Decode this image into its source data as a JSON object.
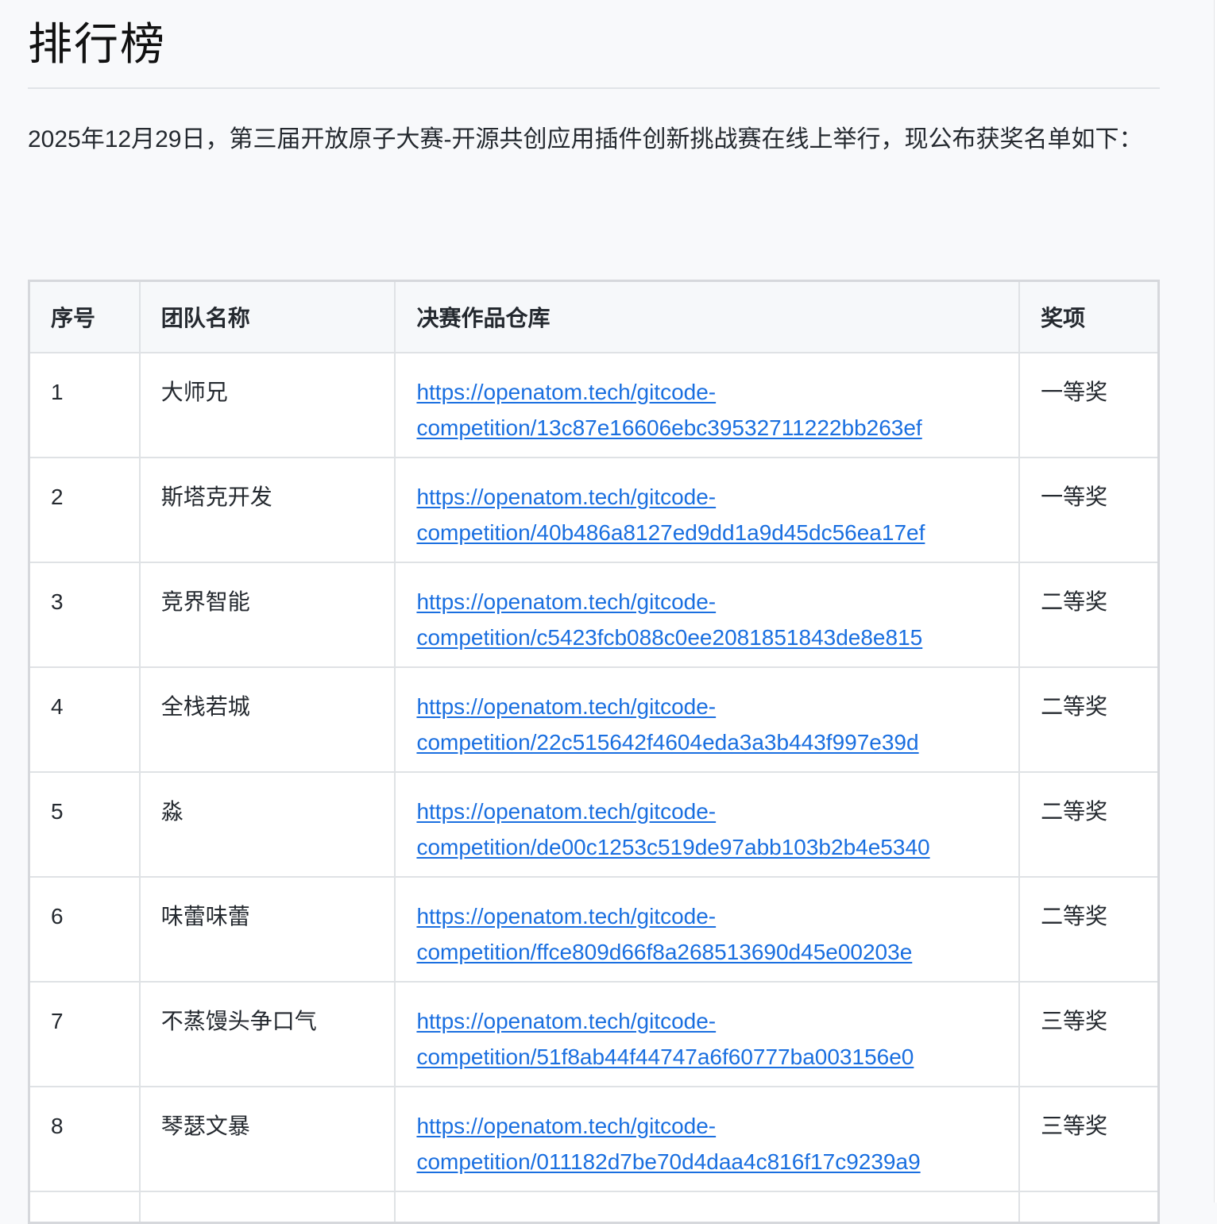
{
  "page": {
    "title": "排行榜",
    "intro": "2025年12月29日，第三届开放原子大赛-开源共创应用插件创新挑战赛在线上举行，现公布获奖名单如下："
  },
  "table": {
    "headers": {
      "num": "序号",
      "team": "团队名称",
      "repo": "决赛作品仓库",
      "award": "奖项"
    },
    "rows": [
      {
        "num": "1",
        "team": "大师兄",
        "repo_line1": "https://openatom.tech/gitcode-",
        "repo_line2": "competition/13c87e16606ebc39532711222bb263ef",
        "award": "一等奖"
      },
      {
        "num": "2",
        "team": "斯塔克开发",
        "repo_line1": "https://openatom.tech/gitcode-",
        "repo_line2": "competition/40b486a8127ed9dd1a9d45dc56ea17ef",
        "award": "一等奖"
      },
      {
        "num": "3",
        "team": "竞界智能",
        "repo_line1": "https://openatom.tech/gitcode-",
        "repo_line2": "competition/c5423fcb088c0ee2081851843de8e815",
        "award": "二等奖"
      },
      {
        "num": "4",
        "team": "全栈若城",
        "repo_line1": "https://openatom.tech/gitcode-",
        "repo_line2": "competition/22c515642f4604eda3a3b443f997e39d",
        "award": "二等奖"
      },
      {
        "num": "5",
        "team": "淼",
        "repo_line1": "https://openatom.tech/gitcode-",
        "repo_line2": "competition/de00c1253c519de97abb103b2b4e5340",
        "award": "二等奖"
      },
      {
        "num": "6",
        "team": "味蕾味蕾",
        "repo_line1": "https://openatom.tech/gitcode-",
        "repo_line2": "competition/ffce809d66f8a268513690d45e00203e",
        "award": "二等奖"
      },
      {
        "num": "7",
        "team": "不蒸馒头争口气",
        "repo_line1": "https://openatom.tech/gitcode-",
        "repo_line2": "competition/51f8ab44f44747a6f60777ba003156e0",
        "award": "三等奖"
      },
      {
        "num": "8",
        "team": "琴瑟文暴",
        "repo_line1": "https://openatom.tech/gitcode-",
        "repo_line2": "competition/011182d7be70d4daa4c816f17c9239a9",
        "award": "三等奖"
      }
    ]
  },
  "colors": {
    "link": "#1a6fe0",
    "text": "#24292f",
    "border": "#dfe2e5",
    "header_bg": "#f6f8fa",
    "page_bg": "#f8f9fb"
  }
}
